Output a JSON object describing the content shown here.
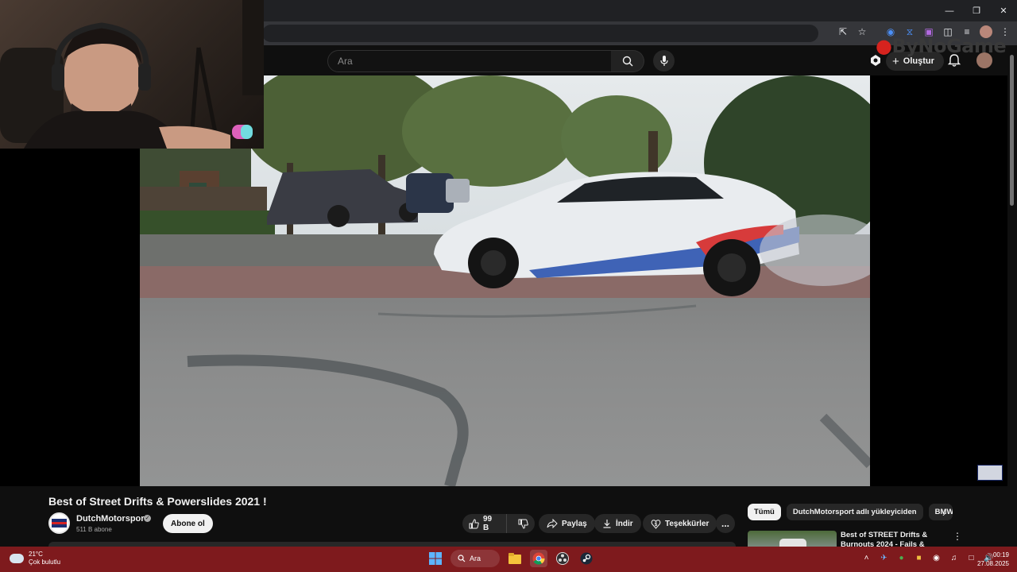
{
  "masthead": {
    "search_placeholder": "Ara",
    "create_label": "Oluştur",
    "watermark_text": "ByNoGame"
  },
  "video": {
    "title": "Best of Street Drifts & Powerslides 2021 !",
    "channel_name": "DutchMotorsport",
    "subscribers": "511 B abone",
    "subscribe_label": "Abone ol",
    "likes": "99 B",
    "share_label": "Paylaş",
    "download_label": "İndir",
    "thanks_label": "Teşekkürler",
    "more_label": "..."
  },
  "sidebar": {
    "chips": [
      "Tümü",
      "DutchMotorsport adlı yükleyiciden",
      "BMW"
    ],
    "recommendation_title": "Best of STREET Drifts & Burnouts 2024 - Fails & Wins!"
  },
  "taskbar": {
    "temperature": "21°C",
    "weather_desc": "Çok bulutlu",
    "search_label": "Ara",
    "time": "00:19",
    "date": "27.08.2025"
  },
  "icons": {
    "window_controls": [
      "minimize-icon",
      "restore-icon",
      "close-icon"
    ],
    "toolbar": [
      "install-app-icon",
      "bookmark-star-icon",
      "extension-icon",
      "extensions-puzzle-icon",
      "media-icon",
      "profile-avatar",
      "chrome-menu-icon"
    ]
  },
  "colors": {
    "taskbar_bg": "#7e1a1d",
    "page_bg": "#0f0f0f",
    "watermark_red": "#d6231e"
  }
}
